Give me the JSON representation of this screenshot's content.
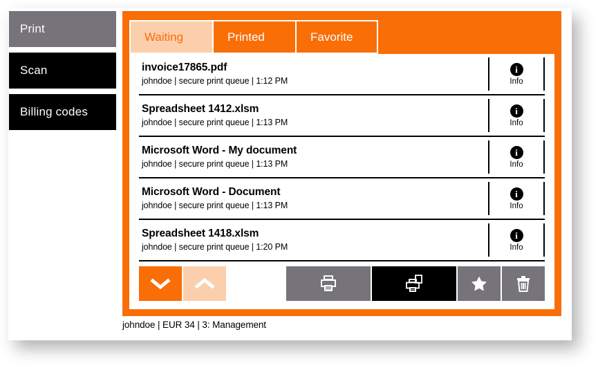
{
  "colors": {
    "brand_orange": "#f96e07",
    "brand_peach": "#fbcfac",
    "gray_button": "#76737a",
    "black": "#000000",
    "white": "#ffffff"
  },
  "sidebar": {
    "items": [
      {
        "label": "Print",
        "state": "active"
      },
      {
        "label": "Scan",
        "state": "plain"
      },
      {
        "label": "Billing codes",
        "state": "plain"
      }
    ]
  },
  "tabs": [
    {
      "label": "Waiting",
      "state": "active"
    },
    {
      "label": "Printed",
      "state": "inactive"
    },
    {
      "label": "Favorite",
      "state": "inactive"
    }
  ],
  "jobs": [
    {
      "title": "invoice17865.pdf",
      "meta": "johndoe | secure print queue | 1:12 PM",
      "info_label": "Info",
      "info_glyph": "info-icon"
    },
    {
      "title": "Spreadsheet 1412.xlsm",
      "meta": "johndoe | secure print queue | 1:13 PM",
      "info_label": "Info",
      "info_glyph": "info-icon"
    },
    {
      "title": "Microsoft Word - My document",
      "meta": "johndoe | secure print queue | 1:13 PM",
      "info_label": "Info",
      "info_glyph": "info-icon"
    },
    {
      "title": "Microsoft Word - Document",
      "meta": "johndoe | secure print queue | 1:13 PM",
      "info_label": "Info",
      "info_glyph": "info-icon"
    },
    {
      "title": "Spreadsheet 1418.xlsm",
      "meta": "johndoe | secure print queue | 1:20 PM",
      "info_label": "Info",
      "info_glyph": "info-icon"
    }
  ],
  "toolbar": {
    "scroll_down": {
      "icon": "chevron-down-icon",
      "state": "enabled"
    },
    "scroll_up": {
      "icon": "chevron-up-icon",
      "state": "disabled"
    },
    "print": {
      "icon": "printer-icon",
      "state": "enabled"
    },
    "print_and_keep": {
      "icon": "print-and-keep-icon",
      "state": "selected"
    },
    "favorite": {
      "icon": "star-icon",
      "state": "enabled"
    },
    "delete": {
      "icon": "trash-icon",
      "state": "enabled"
    }
  },
  "status_bar": {
    "text": "johndoe | EUR 34 | 3: Management"
  }
}
